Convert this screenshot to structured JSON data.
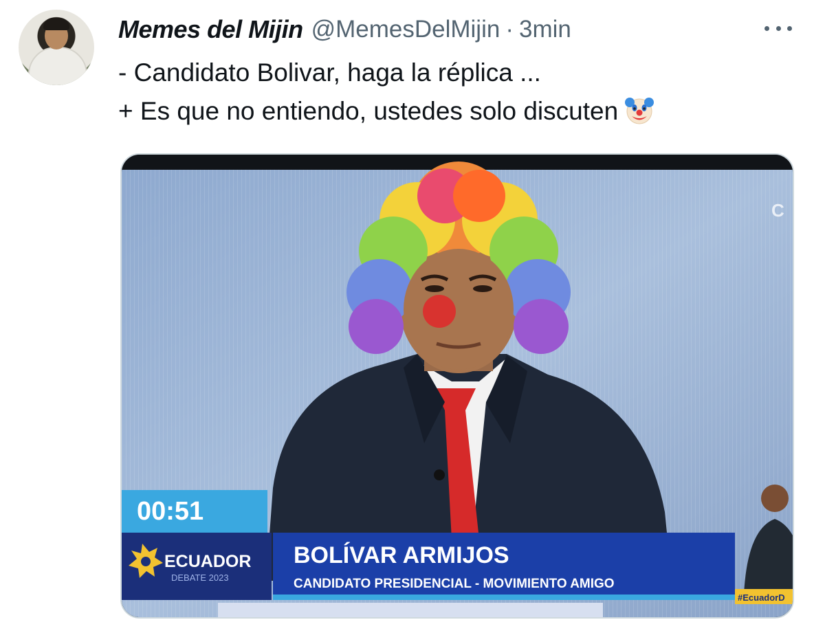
{
  "author": {
    "display_name": "Memes del Mijin",
    "handle": "@MemesDelMijin",
    "separator": "·",
    "timestamp": "3min"
  },
  "tweet": {
    "line1": "- Candidato Bolivar, haga la réplica ...",
    "line2": "+ Es que no entiendo, ustedes solo discuten",
    "emoji": "clown-face-emoji"
  },
  "media": {
    "timer": "00:51",
    "debate_logo_main": "ECUADOR",
    "debate_logo_sub": "DEBATE 2023",
    "lower_third_name": "BOLÍVAR ARMIJOS",
    "lower_third_role": "CANDIDATO PRESIDENCIAL - MOVIMIENTO AMIGO",
    "hashtag": "#EcuadorD",
    "corner_logo": "C"
  },
  "colors": {
    "handle_gray": "#536471",
    "text": "#0f1419",
    "lower_third_blue": "#1b3fa8",
    "timer_blue": "#3aa8e0",
    "tie_red": "#d62a2a"
  }
}
